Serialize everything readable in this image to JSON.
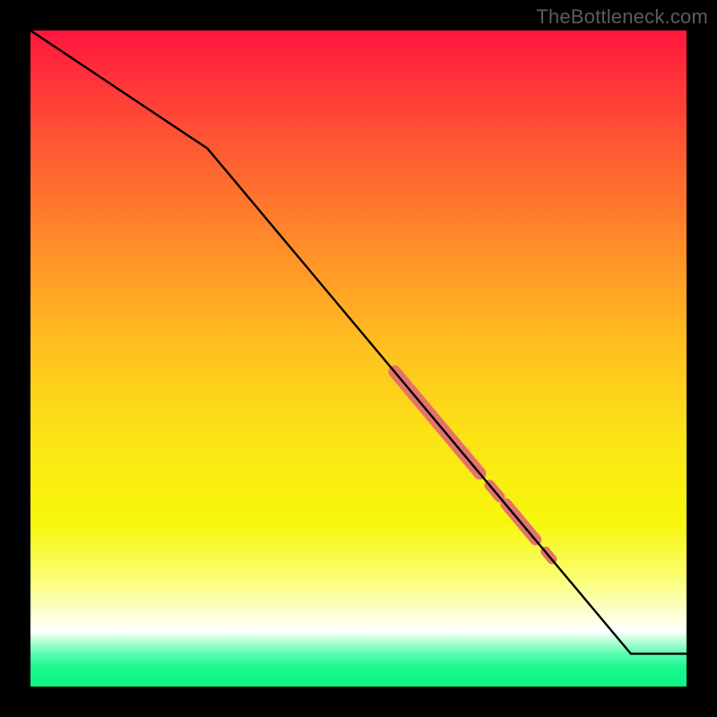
{
  "watermark": "TheBottleneck.com",
  "colors": {
    "line": "#000000",
    "highlight": "#e4726d",
    "background_black": "#000000"
  },
  "chart_data": {
    "type": "line",
    "title": "",
    "xlabel": "",
    "ylabel": "",
    "xlim": [
      0,
      100
    ],
    "ylim": [
      0,
      100
    ],
    "grid": false,
    "note": "No axis ticks or labels shown; x/y are normalized 0–100 over the colored plot area. y=100 is top, y=0 is bottom.",
    "series": [
      {
        "name": "bottleneck-curve",
        "x": [
          0,
          27,
          91.5,
          100
        ],
        "y": [
          100,
          82,
          5,
          5
        ]
      }
    ],
    "highlight_segments": [
      {
        "name": "highlight-main",
        "x": [
          55.5,
          68.5
        ],
        "y": [
          48.0,
          32.5
        ]
      },
      {
        "name": "highlight-dot-1",
        "x": [
          70.0,
          71.5
        ],
        "y": [
          30.7,
          28.9
        ]
      },
      {
        "name": "highlight-short",
        "x": [
          72.5,
          77.0
        ],
        "y": [
          27.8,
          22.4
        ]
      },
      {
        "name": "highlight-dot-2",
        "x": [
          78.5,
          79.5
        ],
        "y": [
          20.6,
          19.4
        ]
      }
    ],
    "gradient_stops_top_to_bottom": [
      {
        "pct": 0,
        "color": "#ff163e"
      },
      {
        "pct": 16,
        "color": "#ff5334"
      },
      {
        "pct": 32,
        "color": "#ff8a2a"
      },
      {
        "pct": 48,
        "color": "#ffbf1f"
      },
      {
        "pct": 62,
        "color": "#fbe416"
      },
      {
        "pct": 75,
        "color": "#f7f70c"
      },
      {
        "pct": 83,
        "color": "#fafd6c"
      },
      {
        "pct": 89,
        "color": "#fdffd6"
      },
      {
        "pct": 91.5,
        "color": "#ffffff"
      },
      {
        "pct": 93,
        "color": "#b9ffd9"
      },
      {
        "pct": 95,
        "color": "#5cfcb1"
      },
      {
        "pct": 97,
        "color": "#1df890"
      },
      {
        "pct": 100,
        "color": "#0af684"
      }
    ]
  }
}
